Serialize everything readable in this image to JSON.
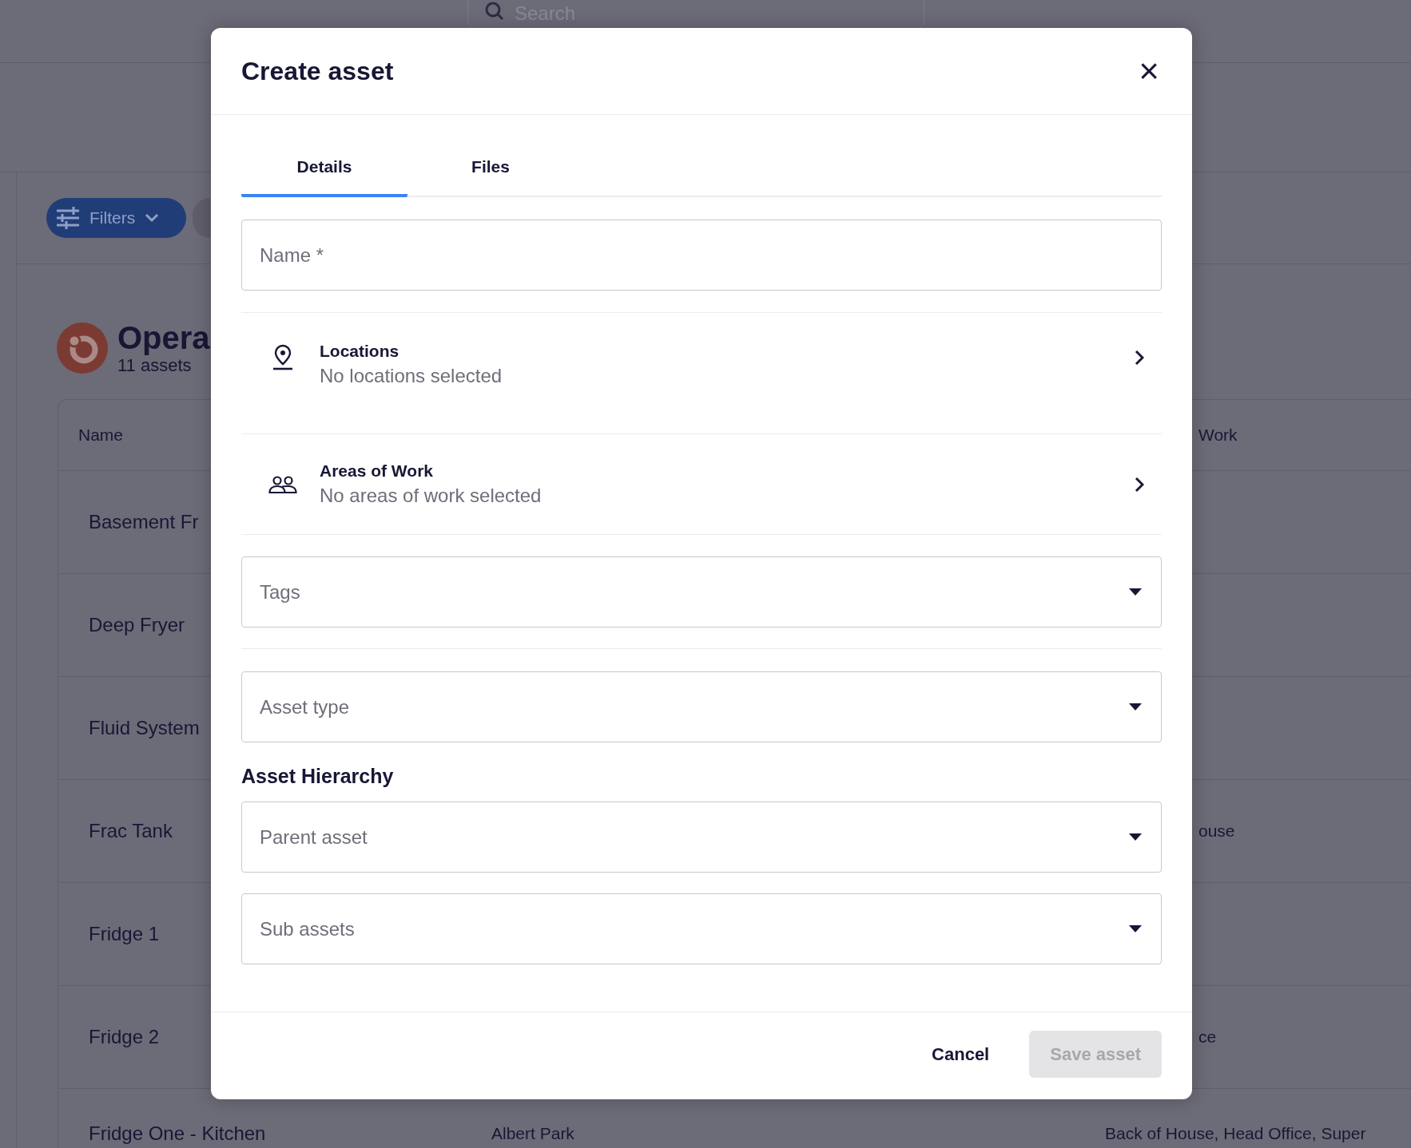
{
  "page": {
    "search": {
      "placeholder": "Search"
    },
    "filters_button": "Filters",
    "group": {
      "title": "Opera",
      "count": "11 assets"
    },
    "table": {
      "columns": [
        {
          "label": "Name"
        },
        {
          "label": "Work"
        }
      ],
      "rows": [
        {
          "name": "Basement Fr"
        },
        {
          "name": "Deep Fryer"
        },
        {
          "name": "Fluid System"
        },
        {
          "name": "Frac Tank",
          "column_3": "ouse"
        },
        {
          "name": "Fridge 1"
        },
        {
          "name": "Fridge 2",
          "column_3": "ce"
        },
        {
          "name": "Fridge One - Kitchen",
          "column_2": "Albert Park",
          "column_3": "Back of House, Head Office, Super"
        }
      ]
    }
  },
  "dialog": {
    "title": "Create asset",
    "close": "×",
    "tabs": [
      {
        "label": "Details",
        "selected": true
      },
      {
        "label": "Files",
        "selected": false
      }
    ],
    "fields": [
      {
        "kind": "input",
        "placeholder": "Name *"
      },
      {
        "kind": "picker",
        "label": "Locations",
        "value": "No locations selected"
      },
      {
        "kind": "picker",
        "label": "Areas of Work",
        "value": "No areas of work selected"
      },
      {
        "kind": "select",
        "placeholder": "Tags"
      },
      {
        "kind": "select",
        "placeholder": "Asset type"
      },
      {
        "kind": "heading",
        "text": "Asset Hierarchy"
      },
      {
        "kind": "select",
        "placeholder": "Parent asset"
      },
      {
        "kind": "select",
        "placeholder": "Sub assets"
      }
    ],
    "buttons": [
      {
        "label": "Cancel",
        "disabled": false
      },
      {
        "label": "Save asset",
        "disabled": true
      }
    ]
  }
}
